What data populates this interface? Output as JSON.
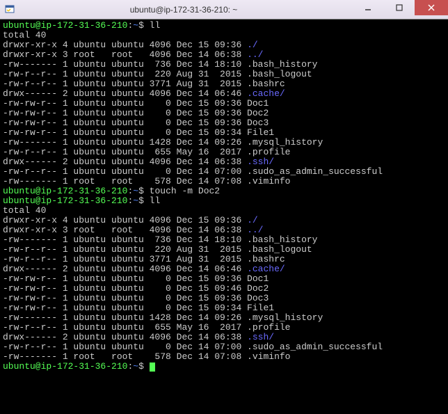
{
  "title": "ubuntu@ip-172-31-36-210: ~",
  "prompt": {
    "user_host": "ubuntu@ip-172-31-36-210",
    "colon": ":",
    "path": "~",
    "dollar": "$"
  },
  "cmd1": "ll",
  "total1": "total 40",
  "ls1": [
    {
      "perm": "drwxr-xr-x",
      "links": "4",
      "owner": "ubuntu",
      "group": "ubuntu",
      "size": "4096",
      "date": "Dec 15 09:36",
      "name": "./",
      "type": "dir"
    },
    {
      "perm": "drwxr-xr-x",
      "links": "3",
      "owner": "root  ",
      "group": "root  ",
      "size": "4096",
      "date": "Dec 14 06:38",
      "name": "../",
      "type": "dir"
    },
    {
      "perm": "-rw-------",
      "links": "1",
      "owner": "ubuntu",
      "group": "ubuntu",
      "size": " 736",
      "date": "Dec 14 18:10",
      "name": ".bash_history",
      "type": "file"
    },
    {
      "perm": "-rw-r--r--",
      "links": "1",
      "owner": "ubuntu",
      "group": "ubuntu",
      "size": " 220",
      "date": "Aug 31  2015",
      "name": ".bash_logout",
      "type": "file"
    },
    {
      "perm": "-rw-r--r--",
      "links": "1",
      "owner": "ubuntu",
      "group": "ubuntu",
      "size": "3771",
      "date": "Aug 31  2015",
      "name": ".bashrc",
      "type": "file"
    },
    {
      "perm": "drwx------",
      "links": "2",
      "owner": "ubuntu",
      "group": "ubuntu",
      "size": "4096",
      "date": "Dec 14 06:46",
      "name": ".cache/",
      "type": "dir"
    },
    {
      "perm": "-rw-rw-r--",
      "links": "1",
      "owner": "ubuntu",
      "group": "ubuntu",
      "size": "   0",
      "date": "Dec 15 09:36",
      "name": "Doc1",
      "type": "file"
    },
    {
      "perm": "-rw-rw-r--",
      "links": "1",
      "owner": "ubuntu",
      "group": "ubuntu",
      "size": "   0",
      "date": "Dec 15 09:36",
      "name": "Doc2",
      "type": "file"
    },
    {
      "perm": "-rw-rw-r--",
      "links": "1",
      "owner": "ubuntu",
      "group": "ubuntu",
      "size": "   0",
      "date": "Dec 15 09:36",
      "name": "Doc3",
      "type": "file"
    },
    {
      "perm": "-rw-rw-r--",
      "links": "1",
      "owner": "ubuntu",
      "group": "ubuntu",
      "size": "   0",
      "date": "Dec 15 09:34",
      "name": "File1",
      "type": "file"
    },
    {
      "perm": "-rw-------",
      "links": "1",
      "owner": "ubuntu",
      "group": "ubuntu",
      "size": "1428",
      "date": "Dec 14 09:26",
      "name": ".mysql_history",
      "type": "file"
    },
    {
      "perm": "-rw-r--r--",
      "links": "1",
      "owner": "ubuntu",
      "group": "ubuntu",
      "size": " 655",
      "date": "May 16  2017",
      "name": ".profile",
      "type": "file"
    },
    {
      "perm": "drwx------",
      "links": "2",
      "owner": "ubuntu",
      "group": "ubuntu",
      "size": "4096",
      "date": "Dec 14 06:38",
      "name": ".ssh/",
      "type": "dir"
    },
    {
      "perm": "-rw-r--r--",
      "links": "1",
      "owner": "ubuntu",
      "group": "ubuntu",
      "size": "   0",
      "date": "Dec 14 07:00",
      "name": ".sudo_as_admin_successful",
      "type": "file"
    },
    {
      "perm": "-rw-------",
      "links": "1",
      "owner": "root  ",
      "group": "root  ",
      "size": " 578",
      "date": "Dec 14 07:08",
      "name": ".viminfo",
      "type": "file"
    }
  ],
  "cmd2": "touch -m Doc2",
  "cmd3": "ll",
  "total2": "total 40",
  "ls2": [
    {
      "perm": "drwxr-xr-x",
      "links": "4",
      "owner": "ubuntu",
      "group": "ubuntu",
      "size": "4096",
      "date": "Dec 15 09:36",
      "name": "./",
      "type": "dir"
    },
    {
      "perm": "drwxr-xr-x",
      "links": "3",
      "owner": "root  ",
      "group": "root  ",
      "size": "4096",
      "date": "Dec 14 06:38",
      "name": "../",
      "type": "dir"
    },
    {
      "perm": "-rw-------",
      "links": "1",
      "owner": "ubuntu",
      "group": "ubuntu",
      "size": " 736",
      "date": "Dec 14 18:10",
      "name": ".bash_history",
      "type": "file"
    },
    {
      "perm": "-rw-r--r--",
      "links": "1",
      "owner": "ubuntu",
      "group": "ubuntu",
      "size": " 220",
      "date": "Aug 31  2015",
      "name": ".bash_logout",
      "type": "file"
    },
    {
      "perm": "-rw-r--r--",
      "links": "1",
      "owner": "ubuntu",
      "group": "ubuntu",
      "size": "3771",
      "date": "Aug 31  2015",
      "name": ".bashrc",
      "type": "file"
    },
    {
      "perm": "drwx------",
      "links": "2",
      "owner": "ubuntu",
      "group": "ubuntu",
      "size": "4096",
      "date": "Dec 14 06:46",
      "name": ".cache/",
      "type": "dir"
    },
    {
      "perm": "-rw-rw-r--",
      "links": "1",
      "owner": "ubuntu",
      "group": "ubuntu",
      "size": "   0",
      "date": "Dec 15 09:36",
      "name": "Doc1",
      "type": "file"
    },
    {
      "perm": "-rw-rw-r--",
      "links": "1",
      "owner": "ubuntu",
      "group": "ubuntu",
      "size": "   0",
      "date": "Dec 15 09:46",
      "name": "Doc2",
      "type": "file"
    },
    {
      "perm": "-rw-rw-r--",
      "links": "1",
      "owner": "ubuntu",
      "group": "ubuntu",
      "size": "   0",
      "date": "Dec 15 09:36",
      "name": "Doc3",
      "type": "file"
    },
    {
      "perm": "-rw-rw-r--",
      "links": "1",
      "owner": "ubuntu",
      "group": "ubuntu",
      "size": "   0",
      "date": "Dec 15 09:34",
      "name": "File1",
      "type": "file"
    },
    {
      "perm": "-rw-------",
      "links": "1",
      "owner": "ubuntu",
      "group": "ubuntu",
      "size": "1428",
      "date": "Dec 14 09:26",
      "name": ".mysql_history",
      "type": "file"
    },
    {
      "perm": "-rw-r--r--",
      "links": "1",
      "owner": "ubuntu",
      "group": "ubuntu",
      "size": " 655",
      "date": "May 16  2017",
      "name": ".profile",
      "type": "file"
    },
    {
      "perm": "drwx------",
      "links": "2",
      "owner": "ubuntu",
      "group": "ubuntu",
      "size": "4096",
      "date": "Dec 14 06:38",
      "name": ".ssh/",
      "type": "dir"
    },
    {
      "perm": "-rw-r--r--",
      "links": "1",
      "owner": "ubuntu",
      "group": "ubuntu",
      "size": "   0",
      "date": "Dec 14 07:00",
      "name": ".sudo_as_admin_successful",
      "type": "file"
    },
    {
      "perm": "-rw-------",
      "links": "1",
      "owner": "root  ",
      "group": "root  ",
      "size": " 578",
      "date": "Dec 14 07:08",
      "name": ".viminfo",
      "type": "file"
    }
  ]
}
